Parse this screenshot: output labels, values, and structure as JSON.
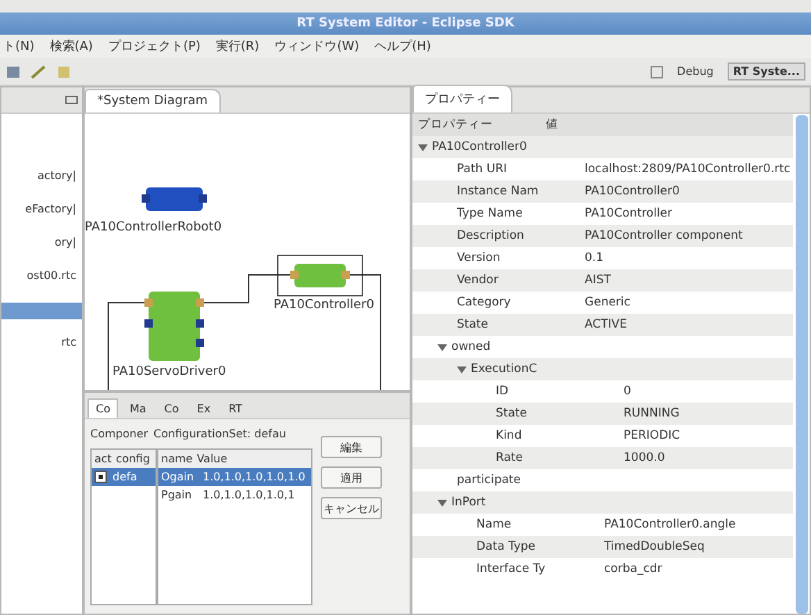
{
  "window": {
    "title": "RT System Editor - Eclipse SDK"
  },
  "menu": [
    "ト(N)",
    "検索(A)",
    "プロジェクト(P)",
    "実行(R)",
    "ウィンドウ(W)",
    "ヘルプ(H)"
  ],
  "perspectives": [
    {
      "label": "Debug",
      "selected": false
    },
    {
      "label": "RT Syste...",
      "selected": true
    }
  ],
  "left_panel": {
    "items": [
      {
        "label": "actory|",
        "selected": false
      },
      {
        "label": "eFactory|",
        "selected": false
      },
      {
        "label": "ory|",
        "selected": false
      },
      {
        "label": "ost00.rtc",
        "selected": false
      },
      {
        "selected": true
      },
      {
        "label": "rtc",
        "selected": false
      }
    ]
  },
  "diagram": {
    "tab": "*System Diagram",
    "components": [
      {
        "name": "PA10ControllerRobot0",
        "color": "#2050c0",
        "kind": "small",
        "selected": false
      },
      {
        "name": "PA10Controller0",
        "color": "#70c040",
        "kind": "small",
        "selected": true
      },
      {
        "name": "PA10ServoDriver0",
        "color": "#70c040",
        "kind": "large",
        "selected": false
      }
    ]
  },
  "config": {
    "tabs": [
      {
        "label": "Co",
        "selected": true
      },
      {
        "label": "Ma",
        "selected": false
      },
      {
        "label": "Co",
        "selected": false
      },
      {
        "label": "Ex",
        "selected": false
      },
      {
        "label": "RT",
        "selected": false
      }
    ],
    "component_label": "Componer",
    "set_label": "ConfigurationSet: defau",
    "set_columns": [
      "act",
      "config"
    ],
    "sets": [
      {
        "active": true,
        "name": "defa",
        "selected": true
      }
    ],
    "param_columns": [
      "name",
      "Value"
    ],
    "params": [
      {
        "name": "Ogain",
        "value": "1.0,1.0,1.0,1.0,1.0",
        "selected": true
      },
      {
        "name": "Pgain",
        "value": "1.0,1.0,1.0,1.0,1",
        "selected": false
      }
    ],
    "buttons": [
      "編集",
      "適用",
      "キャンセル"
    ]
  },
  "properties": {
    "tab": "プロパティー",
    "columns": [
      "プロパティー",
      "値"
    ],
    "tree": [
      {
        "name": "PA10Controller0",
        "expanded": true,
        "children": [
          {
            "name": "Path URI",
            "value": "localhost:2809/PA10Controller0.rtc"
          },
          {
            "name": "Instance Nam",
            "value": "PA10Controller0"
          },
          {
            "name": "Type Name",
            "value": "PA10Controller"
          },
          {
            "name": "Description",
            "value": "PA10Controller component"
          },
          {
            "name": "Version",
            "value": "0.1"
          },
          {
            "name": "Vendor",
            "value": "AIST"
          },
          {
            "name": "Category",
            "value": "Generic"
          },
          {
            "name": "State",
            "value": "ACTIVE"
          },
          {
            "name": "owned",
            "expanded": true,
            "children": [
              {
                "name": "ExecutionC",
                "expanded": true,
                "children": [
                  {
                    "name": "ID",
                    "value": "0"
                  },
                  {
                    "name": "State",
                    "value": "RUNNING"
                  },
                  {
                    "name": "Kind",
                    "value": "PERIODIC"
                  },
                  {
                    "name": "Rate",
                    "value": "1000.0"
                  }
                ]
              }
            ]
          },
          {
            "name": "participate"
          },
          {
            "name": "InPort",
            "expanded": true,
            "children": [
              {
                "name": "Name",
                "value": "PA10Controller0.angle"
              },
              {
                "name": "Data Type",
                "value": "TimedDoubleSeq"
              },
              {
                "name": "Interface Ty",
                "value": "corba_cdr"
              }
            ]
          }
        ]
      }
    ]
  }
}
